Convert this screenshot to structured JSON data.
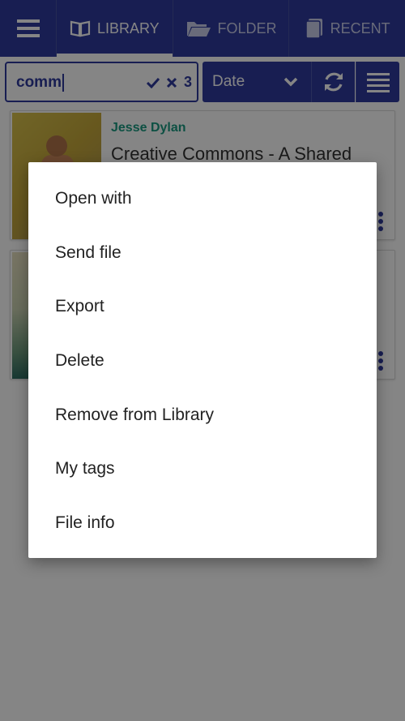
{
  "topbar": {
    "tabs": [
      {
        "label": "LIBRARY",
        "icon": "book-icon"
      },
      {
        "label": "FOLDER",
        "icon": "folder-icon"
      },
      {
        "label": "RECENT",
        "icon": "recent-icon"
      }
    ]
  },
  "search": {
    "value": "comm",
    "result_count": "3"
  },
  "sort": {
    "selected": "Date"
  },
  "books": [
    {
      "author": "Jesse Dylan",
      "title": "Creative Commons - A Shared"
    },
    {
      "author": "",
      "title": ""
    }
  ],
  "context_menu": {
    "items": [
      "Open with",
      "Send file",
      "Export",
      "Delete",
      "Remove from Library",
      "My tags",
      "File info"
    ]
  },
  "colors": {
    "primary": "#2f3a9e",
    "author": "#1a9a80"
  }
}
